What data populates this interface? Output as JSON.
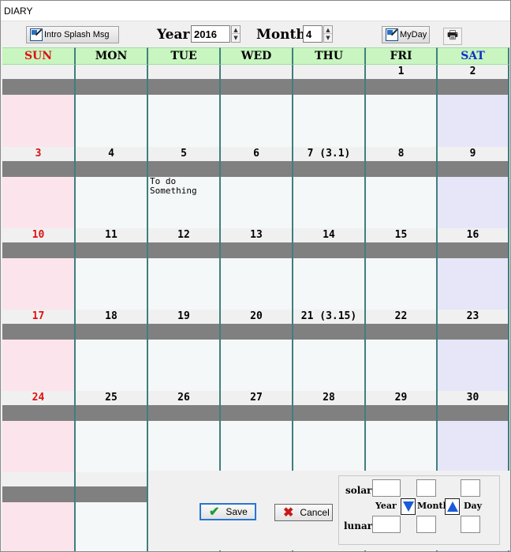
{
  "window": {
    "title": "DIARY"
  },
  "toolbar": {
    "intro_button": "Intro Splash Msg",
    "year_label": "Year",
    "year_value": "2016",
    "month_label": "Month",
    "month_value": "4",
    "myday_button": "MyDay",
    "print_icon": "printer-icon"
  },
  "calendar": {
    "weekdays": [
      "SUN",
      "MON",
      "TUE",
      "WED",
      "THU",
      "FRI",
      "SAT"
    ],
    "colors": {
      "sunday": "#e01010",
      "saturday": "#1030c8",
      "header_bg": "#c8f5c0",
      "note_bar": "#808080"
    },
    "weeks": [
      [
        "",
        "",
        "",
        "",
        "",
        "1",
        "2"
      ],
      [
        "3",
        "4",
        "5",
        "6",
        "7 (3.1)",
        "8",
        "9"
      ],
      [
        "10",
        "11",
        "12",
        "13",
        "14",
        "15",
        "16"
      ],
      [
        "17",
        "18",
        "19",
        "20",
        "21 (3.15)",
        "22",
        "23"
      ],
      [
        "24",
        "25",
        "26",
        "27",
        "28",
        "29",
        "30"
      ],
      [
        "",
        "",
        "",
        "",
        "",
        "",
        ""
      ]
    ],
    "notes": {
      "2016-04-05": "To do\nSomething"
    }
  },
  "actions": {
    "save": "Save",
    "cancel": "Cancel"
  },
  "converter": {
    "solar_label": "solar",
    "lunar_label": "lunar",
    "year_label": "Year",
    "month_label": "Month",
    "day_label": "Day",
    "down_icon": "down-arrow-icon",
    "up_icon": "up-arrow-icon"
  }
}
